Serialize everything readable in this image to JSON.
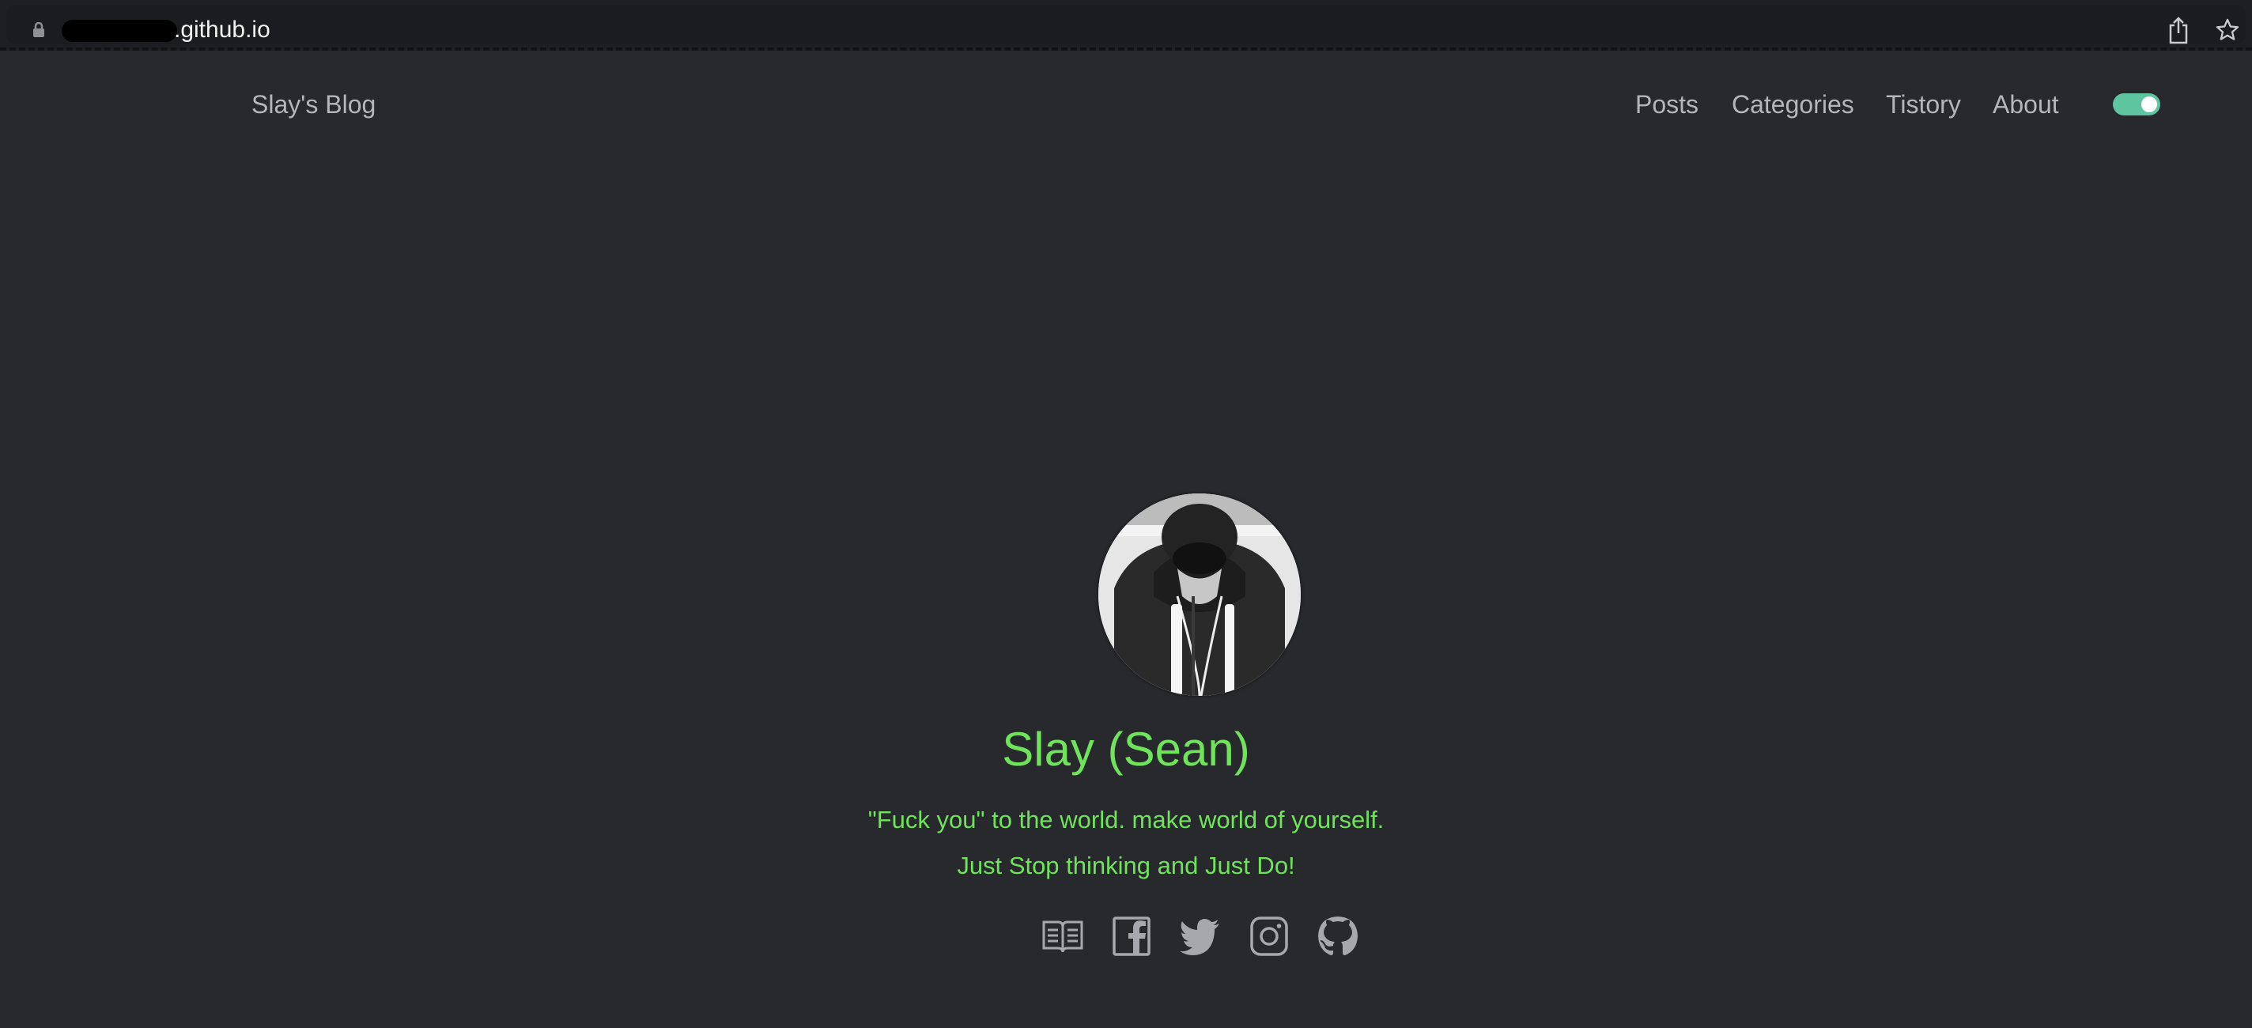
{
  "browser": {
    "url_visible": ".github.io",
    "share_icon": "share-icon",
    "bookmark_icon": "star-icon",
    "lock_icon": "lock-icon"
  },
  "header": {
    "site_title": "Slay's Blog",
    "nav": [
      "Posts",
      "Categories",
      "Tistory",
      "About"
    ],
    "theme_toggle_on": true,
    "toggle_color": "#5fc5a0"
  },
  "profile": {
    "name": "Slay (Sean)",
    "bio": [
      "\"Fuck you\" to the world. make world of yourself.",
      "Just Stop thinking and Just Do!"
    ],
    "accent_color": "#6fe35a",
    "social_icons": [
      "blog-icon",
      "facebook-icon",
      "twitter-icon",
      "instagram-icon",
      "github-icon"
    ]
  },
  "colors": {
    "background": "#27292d",
    "nav_text": "#b4b6bb"
  }
}
